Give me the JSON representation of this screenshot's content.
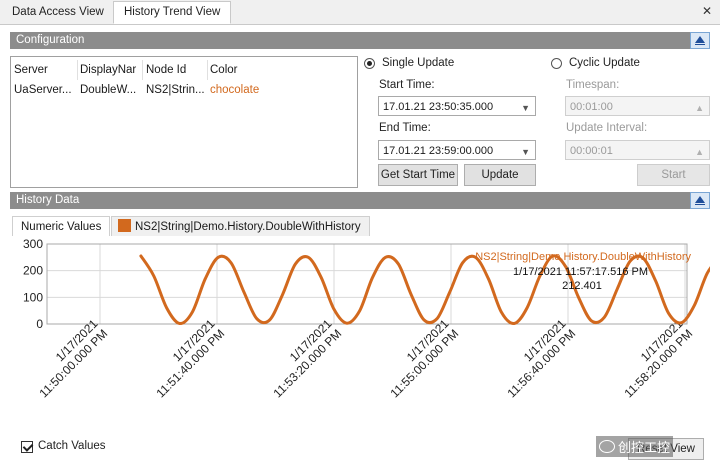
{
  "tabs": {
    "data_access": "Data Access View",
    "history_trend": "History Trend View"
  },
  "config": {
    "header": "Configuration",
    "columns": [
      "Server",
      "DisplayNar",
      "Node Id",
      "Color"
    ],
    "row": {
      "server": "UaServer...",
      "display_name": "DoubleW...",
      "node_id": "NS2|Strin...",
      "color": "chocolate"
    },
    "single_update_label": "Single Update",
    "start_time_label": "Start Time:",
    "start_time_value": "17.01.21 23:50:35.000",
    "end_time_label": "End Time:",
    "end_time_value": "17.01.21 23:59:00.000",
    "get_start_time_button": "Get Start Time",
    "update_button": "Update",
    "cyclic_update_label": "Cyclic Update",
    "timespan_label": "Timespan:",
    "timespan_value": "00:01:00",
    "update_interval_label": "Update Interval:",
    "update_interval_value": "00:00:01",
    "start_button": "Start"
  },
  "history": {
    "header": "History Data",
    "tab_numeric": "Numeric Values",
    "tab_series": "NS2|String|Demo.History.DoubleWithHistory",
    "catch_values_label": "Catch Values",
    "reset_view_button": "Reset View",
    "watermark": "创控工控"
  },
  "colors": {
    "series": "#d2691e",
    "header_bg": "#8c8c8c"
  },
  "icons": {
    "close": "close-icon",
    "collapse": "collapse-up-icon",
    "dropdown": "chevron-down-icon"
  },
  "chart_data": {
    "type": "line",
    "series": [
      {
        "name": "NS2|String|Demo.History.DoubleWithHistory",
        "color": "#d2691e",
        "x": [
          "11:50:35",
          "11:50:46",
          "11:50:57",
          "11:51:08",
          "11:51:19",
          "11:51:30",
          "11:51:41",
          "11:51:52",
          "11:52:03",
          "11:52:14",
          "11:52:25",
          "11:52:36",
          "11:52:47",
          "11:52:58",
          "11:53:09",
          "11:53:20",
          "11:53:31",
          "11:53:42",
          "11:53:53",
          "11:54:04",
          "11:54:15",
          "11:54:26",
          "11:54:37",
          "11:54:48",
          "11:54:59",
          "11:55:10",
          "11:55:21",
          "11:55:32",
          "11:55:43",
          "11:55:54",
          "11:56:05",
          "11:56:16",
          "11:56:27",
          "11:56:38",
          "11:56:49",
          "11:57:00",
          "11:57:11",
          "11:57:22",
          "11:57:33",
          "11:57:44",
          "11:57:55",
          "11:58:06",
          "11:58:17",
          "11:58:28",
          "11:58:39",
          "11:58:50"
        ],
        "values": [
          255,
          180,
          60,
          2,
          45,
          170,
          250,
          230,
          120,
          20,
          15,
          110,
          225,
          250,
          175,
          55,
          3,
          50,
          175,
          250,
          225,
          110,
          15,
          20,
          120,
          230,
          250,
          170,
          45,
          2,
          60,
          180,
          255,
          215,
          100,
          12,
          25,
          130,
          235,
          248,
          160,
          40,
          5,
          70,
          190,
          255
        ],
        "line_width": 3
      }
    ],
    "x_ticks": [
      "1/17/2021 11:50:00.000 PM",
      "1/17/2021 11:51:40.000 PM",
      "1/17/2021 11:53:20.000 PM",
      "1/17/2021 11:55:00.000 PM",
      "1/17/2021 11:56:40.000 PM",
      "1/17/2021 11:58:20.000 PM"
    ],
    "y_ticks": [
      0,
      100,
      200,
      300
    ],
    "ylim": [
      0,
      300
    ],
    "grid": true,
    "legend": "top-right",
    "annotation": {
      "timestamp": "1/17/2021 11:57:17.516 PM",
      "value": "212.401"
    }
  }
}
